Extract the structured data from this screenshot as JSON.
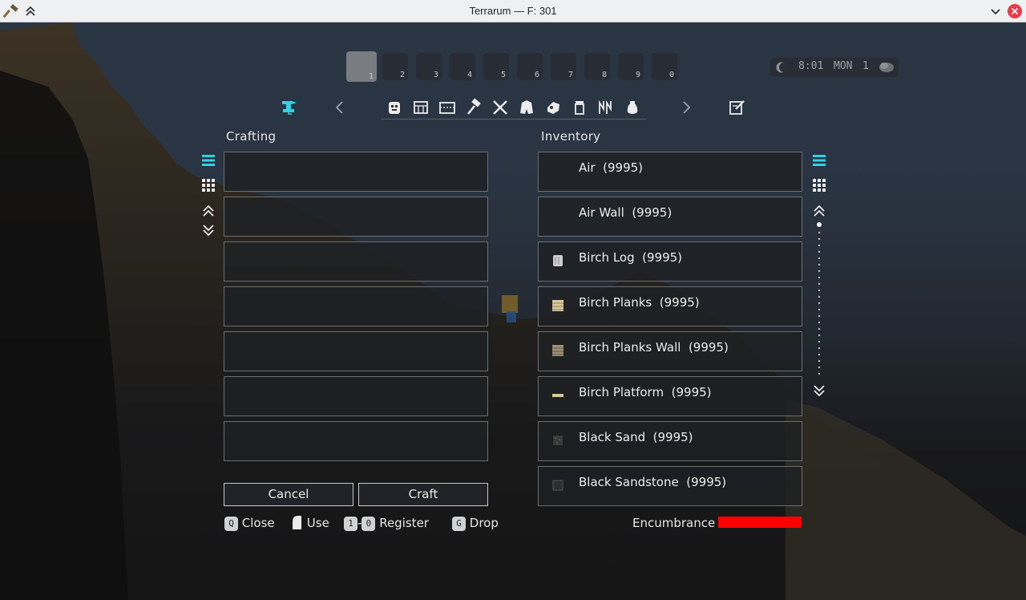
{
  "window": {
    "title": "Terrarum — F: 301"
  },
  "quickslots": [
    "1",
    "2",
    "3",
    "4",
    "5",
    "6",
    "7",
    "8",
    "9",
    "0"
  ],
  "clock": {
    "time": "8:01",
    "day": "MON",
    "date": "1"
  },
  "crafting": {
    "label": "Crafting",
    "cancel_label": "Cancel",
    "craft_label": "Craft"
  },
  "inventory": {
    "label": "Inventory",
    "items": [
      {
        "name": "Air",
        "qty": "(9995)",
        "color": ""
      },
      {
        "name": "Air Wall",
        "qty": "(9995)",
        "color": ""
      },
      {
        "name": "Birch Log",
        "qty": "(9995)",
        "color": "#cfcfcf"
      },
      {
        "name": "Birch Planks",
        "qty": "(9995)",
        "color": "#d8c79a"
      },
      {
        "name": "Birch Planks Wall",
        "qty": "(9995)",
        "color": "#9c9176"
      },
      {
        "name": "Birch Platform",
        "qty": "(9995)",
        "color": "#d8c79a"
      },
      {
        "name": "Black Sand",
        "qty": "(9995)",
        "color": "#3a3a3a"
      },
      {
        "name": "Black Sandstone",
        "qty": "(9995)",
        "color": "#2e2e2e"
      }
    ],
    "encumbrance_label": "Encumbrance",
    "encumbrance_fraction": 1.0
  },
  "hints": {
    "close_key": "Q",
    "close_label": "Close",
    "use_label": "Use",
    "register_key_from": "1",
    "register_dash": "-",
    "register_key_to": "0",
    "register_label": "Register",
    "drop_key": "G",
    "drop_label": "Drop"
  },
  "colors": {
    "accent_cyan": "#2fd3e6",
    "encumbrance_red": "#ff0000"
  }
}
